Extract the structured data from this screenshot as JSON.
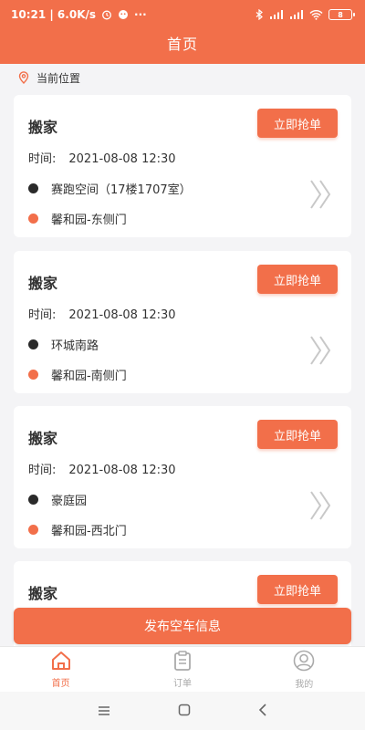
{
  "status_bar": {
    "time_speed": "10:21 | 6.0K/s",
    "battery": "8"
  },
  "header": {
    "title": "首页"
  },
  "location": {
    "label": "当前位置"
  },
  "orders": [
    {
      "type": "搬家",
      "grab_label": "立即抢单",
      "time_label": "时间:",
      "time": "2021-08-08 12:30",
      "from": "赛跑空间（17楼1707室）",
      "to": "馨和园-东侧门"
    },
    {
      "type": "搬家",
      "grab_label": "立即抢单",
      "time_label": "时间:",
      "time": "2021-08-08 12:30",
      "from": "环城南路",
      "to": "馨和园-南侧门"
    },
    {
      "type": "搬家",
      "grab_label": "立即抢单",
      "time_label": "时间:",
      "time": "2021-08-08 12:30",
      "from": "豪庭园",
      "to": "馨和园-西北门"
    },
    {
      "type": "搬家",
      "grab_label": "立即抢单",
      "time_label": "",
      "time": "",
      "from": "",
      "to": ""
    }
  ],
  "publish": {
    "label": "发布空车信息"
  },
  "tabs": [
    {
      "label": "首页",
      "icon": "home-icon",
      "active": true
    },
    {
      "label": "订单",
      "icon": "clipboard-icon",
      "active": false
    },
    {
      "label": "我的",
      "icon": "user-icon",
      "active": false
    }
  ],
  "colors": {
    "accent": "#f26f4a",
    "background": "#f4f4f6"
  }
}
